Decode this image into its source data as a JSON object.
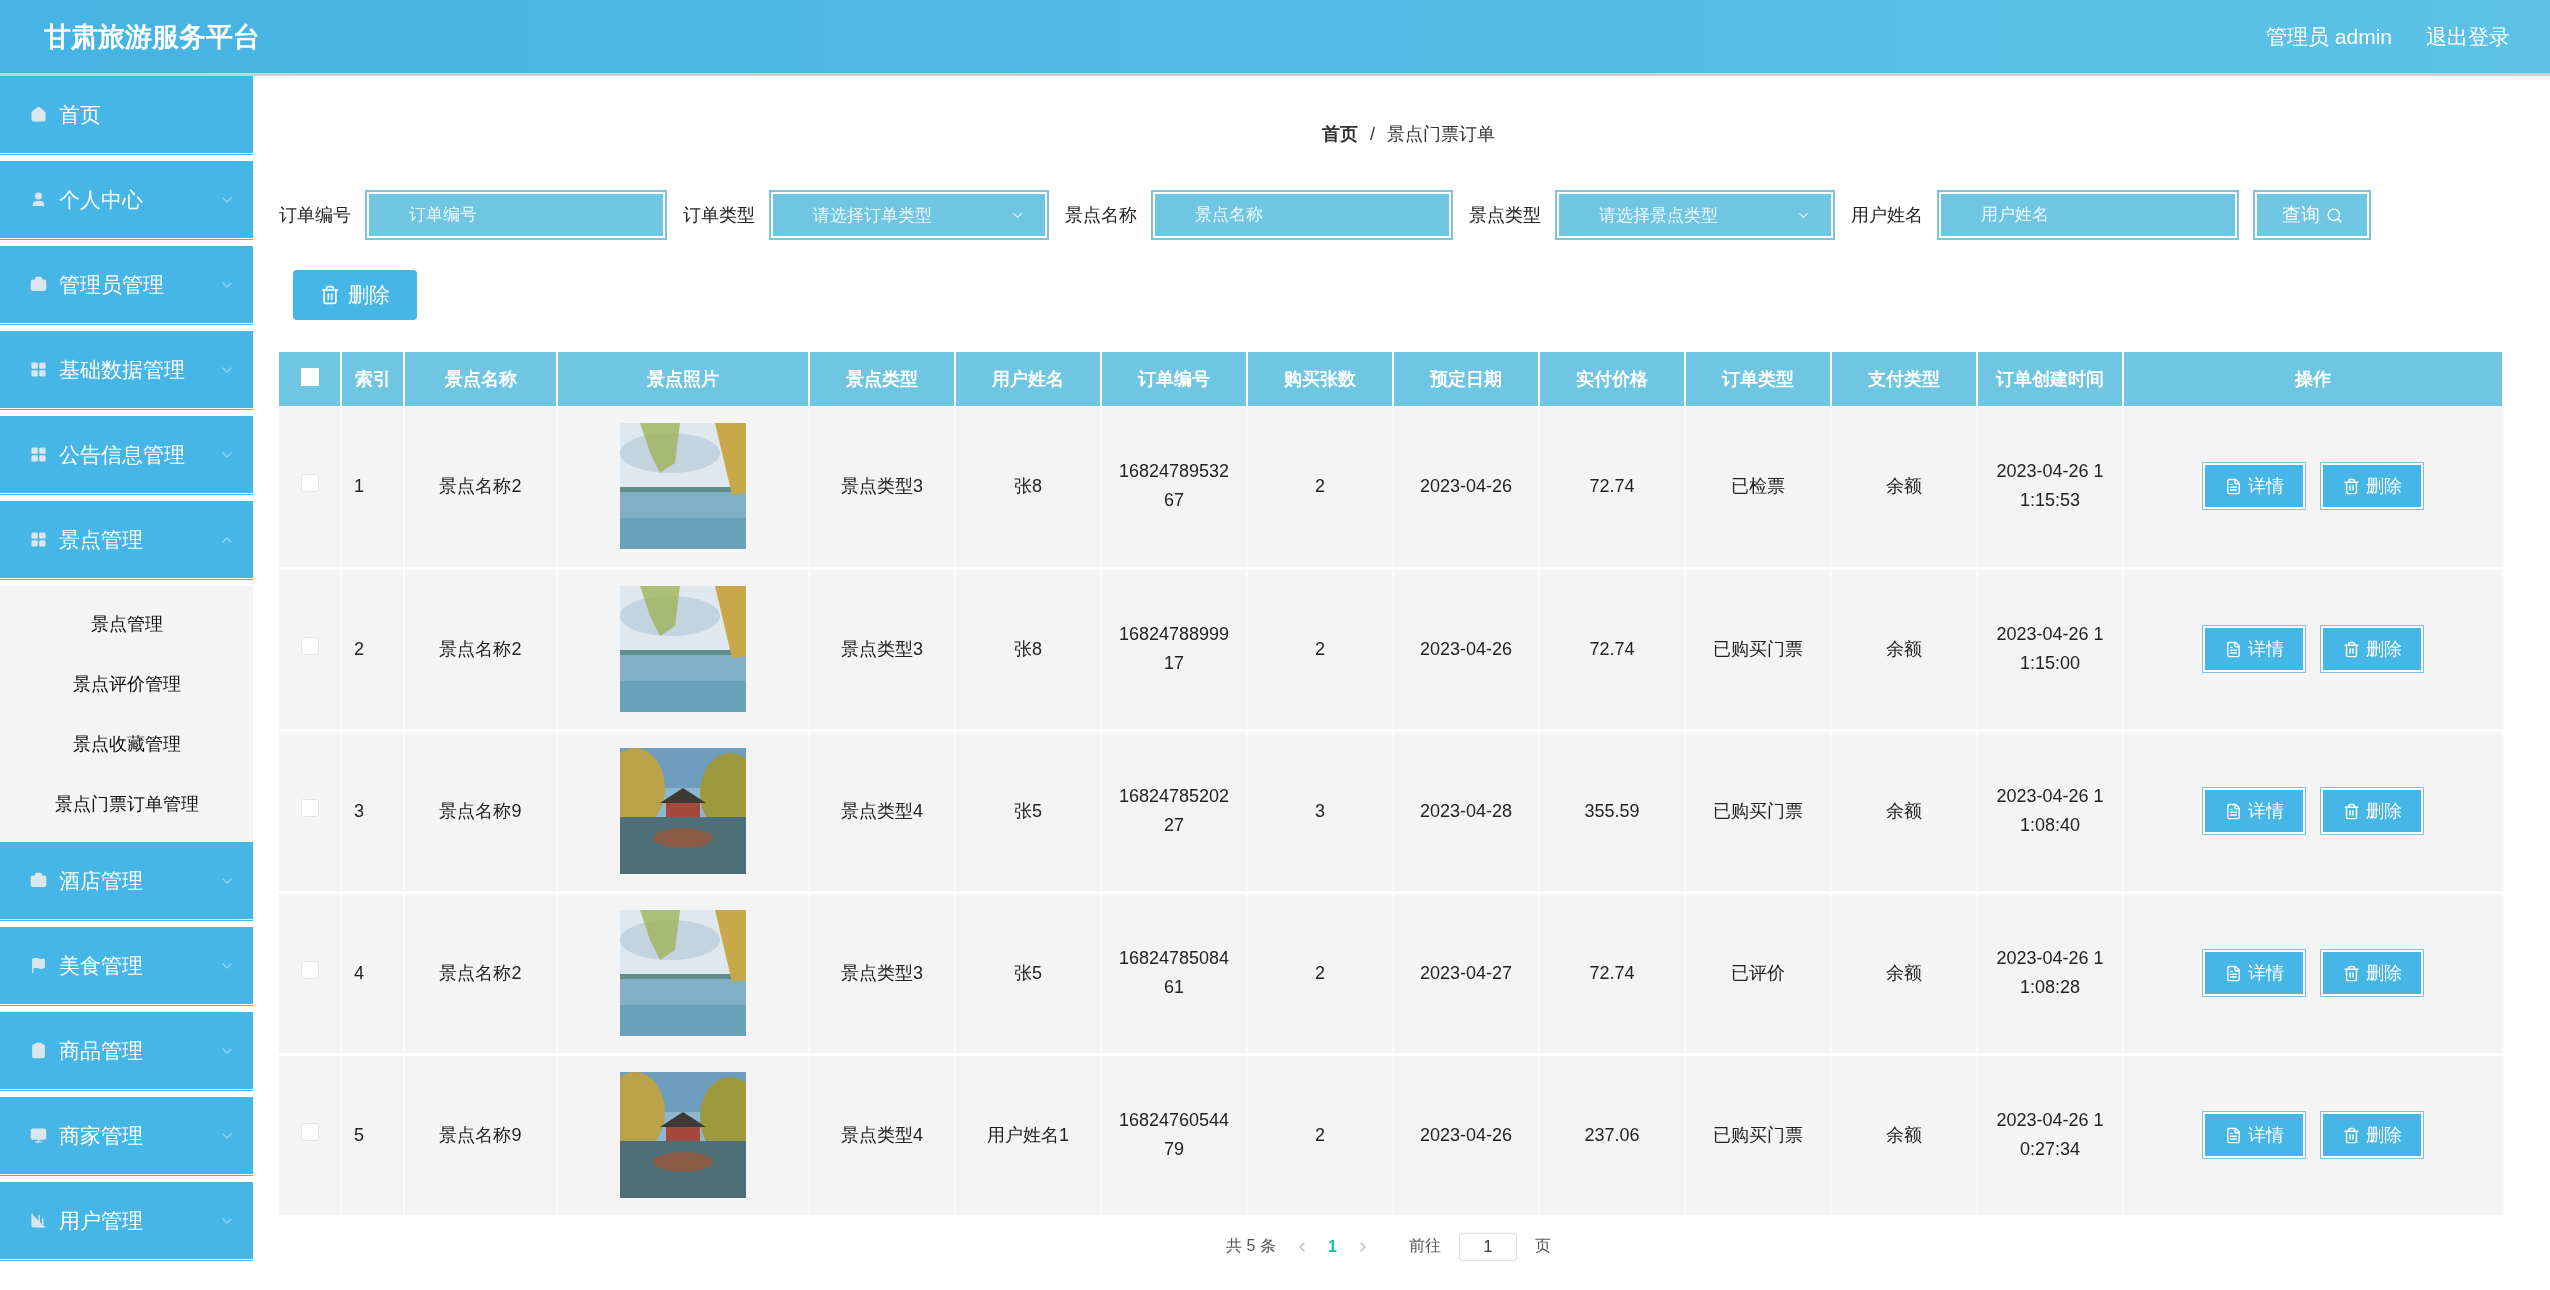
{
  "header": {
    "title": "甘肃旅游服务平台",
    "user": "管理员 admin",
    "logout": "退出登录"
  },
  "sidebar": {
    "items": [
      {
        "label": "首页",
        "expandable": false
      },
      {
        "label": "个人中心",
        "expandable": true,
        "expanded": false
      },
      {
        "label": "管理员管理",
        "expandable": true,
        "expanded": false
      },
      {
        "label": "基础数据管理",
        "expandable": true,
        "expanded": false
      },
      {
        "label": "公告信息管理",
        "expandable": true,
        "expanded": false
      },
      {
        "label": "景点管理",
        "expandable": true,
        "expanded": true,
        "children": [
          {
            "label": "景点管理"
          },
          {
            "label": "景点评价管理"
          },
          {
            "label": "景点收藏管理"
          },
          {
            "label": "景点门票订单管理"
          }
        ]
      },
      {
        "label": "酒店管理",
        "expandable": true,
        "expanded": false
      },
      {
        "label": "美食管理",
        "expandable": true,
        "expanded": false
      },
      {
        "label": "商品管理",
        "expandable": true,
        "expanded": false
      },
      {
        "label": "商家管理",
        "expandable": true,
        "expanded": false
      },
      {
        "label": "用户管理",
        "expandable": true,
        "expanded": false
      }
    ]
  },
  "breadcrumb": [
    "首页",
    "/",
    "景点门票订单"
  ],
  "filters": [
    {
      "kind": "input",
      "label": "订单编号",
      "placeholder": "订单编号"
    },
    {
      "kind": "select",
      "label": "订单类型",
      "placeholder": "请选择订单类型"
    },
    {
      "kind": "input",
      "label": "景点名称",
      "placeholder": "景点名称"
    },
    {
      "kind": "select",
      "label": "景点类型",
      "placeholder": "请选择景点类型"
    },
    {
      "kind": "input",
      "label": "用户姓名",
      "placeholder": "用户姓名"
    }
  ],
  "search_button": "查询",
  "delete_button": "删除",
  "table": {
    "header_checked": false,
    "columns": [
      "索引",
      "景点名称",
      "景点照片",
      "景点类型",
      "用户姓名",
      "订单编号",
      "购买张数",
      "预定日期",
      "实付价格",
      "订单类型",
      "支付类型",
      "订单创建时间",
      "操作"
    ],
    "rows": [
      {
        "checked": false,
        "cells": [
          "1",
          "景点名称2",
          "",
          "景点类型3",
          "张8",
          "1682478953267",
          "2",
          "2023-04-26",
          "72.74",
          "已检票",
          "余额",
          "2023-04-26 11:15:53"
        ],
        "actions": [
          "详情",
          "删除"
        ]
      },
      {
        "checked": false,
        "cells": [
          "2",
          "景点名称2",
          "",
          "景点类型3",
          "张8",
          "1682478899917",
          "2",
          "2023-04-26",
          "72.74",
          "已购买门票",
          "余额",
          "2023-04-26 11:15:00"
        ],
        "actions": [
          "详情",
          "删除"
        ]
      },
      {
        "checked": false,
        "cells": [
          "3",
          "景点名称9",
          "",
          "景点类型4",
          "张5",
          "1682478520227",
          "3",
          "2023-04-28",
          "355.59",
          "已购买门票",
          "余额",
          "2023-04-26 11:08:40"
        ],
        "actions": [
          "详情",
          "删除"
        ]
      },
      {
        "checked": false,
        "cells": [
          "4",
          "景点名称2",
          "",
          "景点类型3",
          "张5",
          "1682478508461",
          "2",
          "2023-04-27",
          "72.74",
          "已评价",
          "余额",
          "2023-04-26 11:08:28"
        ],
        "actions": [
          "详情",
          "删除"
        ]
      },
      {
        "checked": false,
        "cells": [
          "5",
          "景点名称9",
          "",
          "景点类型4",
          "用户姓名1",
          "1682476054479",
          "2",
          "2023-04-26",
          "237.06",
          "已购买门票",
          "余额",
          "2023-04-26 10:27:34"
        ],
        "actions": [
          "详情",
          "删除"
        ]
      }
    ]
  },
  "pagination": {
    "total": "共 5 条",
    "pages": [
      {
        "label": "1",
        "selected": true
      }
    ],
    "goto": "前往",
    "page_value": "1",
    "page_unit": "页"
  }
}
